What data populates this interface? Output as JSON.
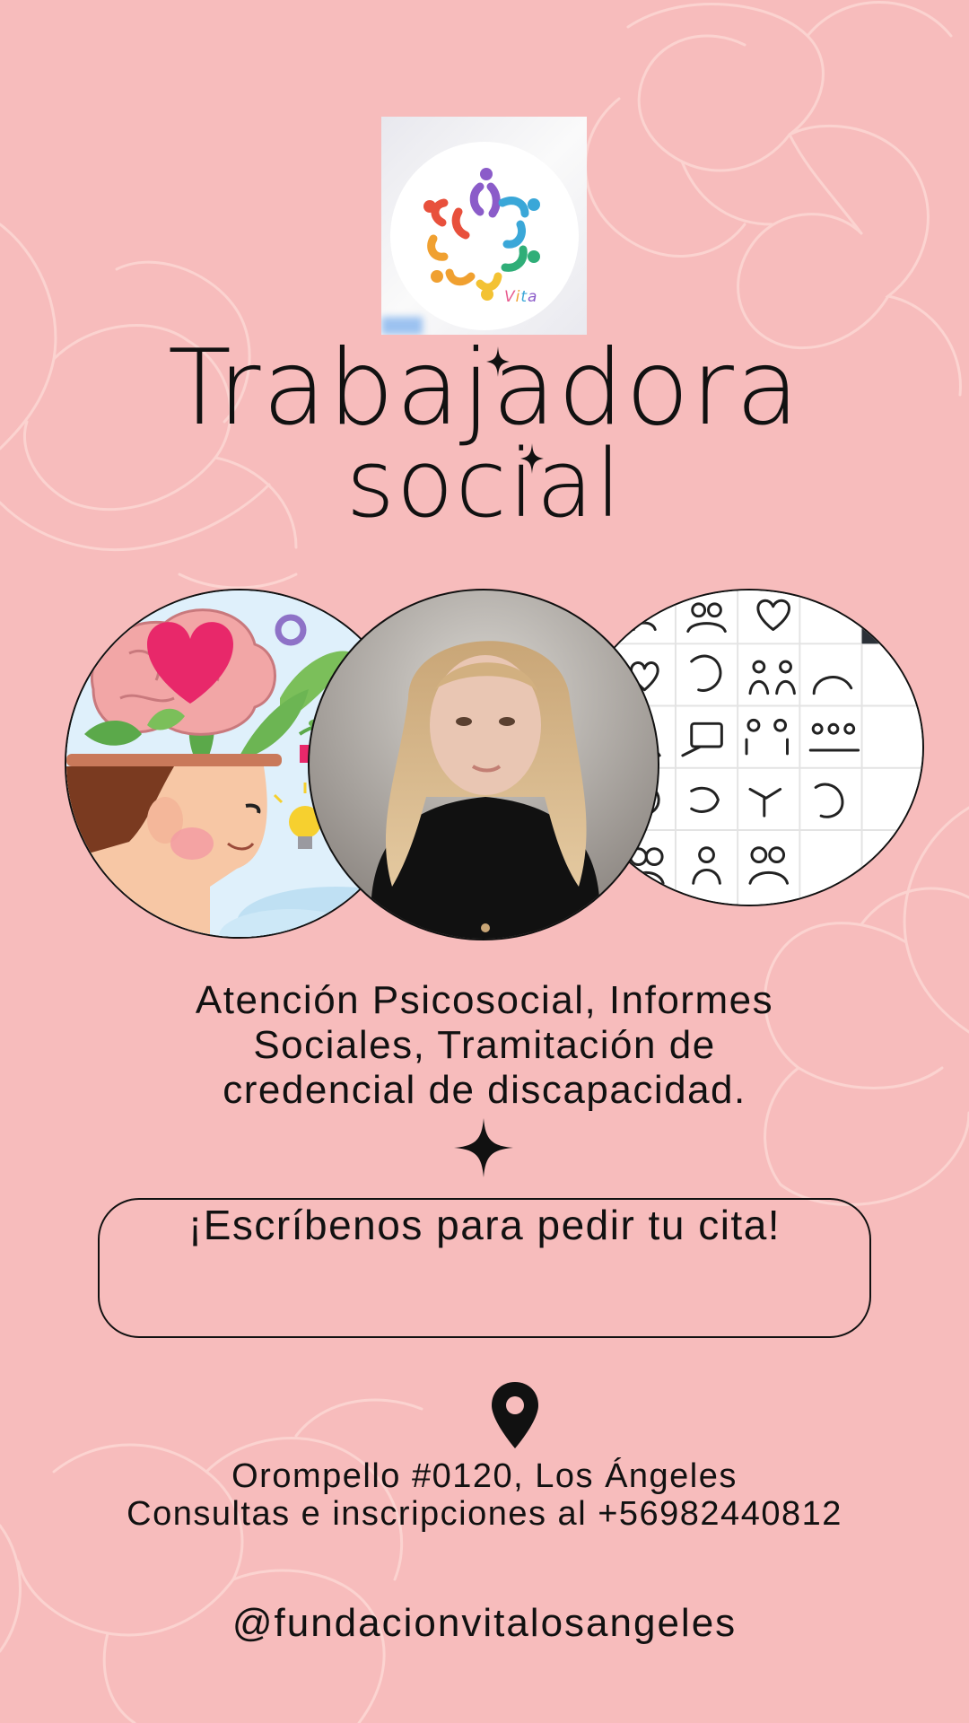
{
  "logo": {
    "icon": "vita-people-star-logo",
    "wordmark": "Vita"
  },
  "title": {
    "line1": "Trabajadora",
    "line2": "social"
  },
  "images": {
    "left": "mental-health-illustration",
    "center": "profile-photo",
    "right": "social-work-icon-grid"
  },
  "services": {
    "line1": "Atención Psicosocial, Informes",
    "line2": "Sociales, Tramitación de",
    "line3": "credencial de discapacidad."
  },
  "cta": {
    "text": "¡Escríbenos para pedir tu cita!"
  },
  "contact": {
    "icon": "location-pin-icon",
    "address": "Orompello #0120, Los Ángeles",
    "phone_line": "Consultas e inscripciones al +56982440812"
  },
  "social": {
    "handle": "@fundacionvitalosangeles"
  },
  "colors": {
    "background": "#f7bcbc",
    "text": "#111111",
    "decor": "#fbd3d0"
  }
}
